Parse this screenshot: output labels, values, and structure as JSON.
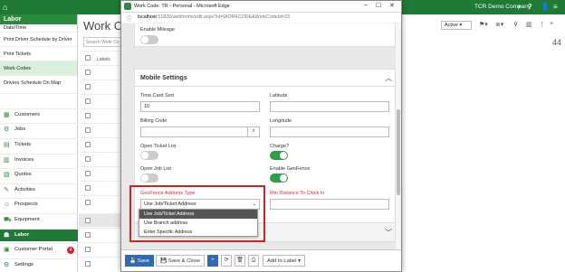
{
  "topbar": {
    "company": "TCR Demo Company",
    "colors": {
      "bg": "#1e7a34"
    }
  },
  "sidebar": {
    "header": "Labor",
    "sub_items": [
      {
        "label": "Date/Time"
      },
      {
        "label": "Print Driver Schedule by Driver"
      },
      {
        "label": "Print Tickets"
      },
      {
        "label": "Work Codes",
        "active": true
      },
      {
        "label": "Drivers Schedule On Map"
      }
    ],
    "nav": [
      {
        "label": "Customers",
        "icon": "building-icon"
      },
      {
        "label": "Jobs",
        "icon": "user-gear-icon"
      },
      {
        "label": "Tickets",
        "icon": "ticket-icon"
      },
      {
        "label": "Invoices",
        "icon": "invoice-icon"
      },
      {
        "label": "Quotes",
        "icon": "quote-icon"
      },
      {
        "label": "Activities",
        "icon": "wrench-icon"
      },
      {
        "label": "Prospects",
        "icon": "prospect-icon"
      },
      {
        "label": "Equipment",
        "icon": "truck-icon"
      },
      {
        "label": "Labor",
        "icon": "users-icon",
        "active": true
      },
      {
        "label": "Customer Portal",
        "icon": "portal-icon",
        "badge": "4"
      },
      {
        "label": "Settings",
        "icon": "gear-icon"
      }
    ]
  },
  "main": {
    "title": "Work Co",
    "search_placeholder": "Search Work Co",
    "labels_header": "Labels",
    "status_select": "Active",
    "count": "44"
  },
  "window": {
    "title": "Work Code: TR - Personal - Microsoft Edge",
    "url_host": "localhost",
    "url_path": ":51826/webforms/edit.aspx?id=WORKCODE&WorkCodeId=23",
    "enable_mileage_label": "Enable Mileage",
    "enable_mileage_on": false,
    "mobile_settings": {
      "title": "Mobile Settings",
      "time_card_sort_label": "Time Card Sort",
      "time_card_sort_value": "10",
      "latitude_label": "Latitude",
      "latitude_value": "",
      "billing_code_label": "Billing Code",
      "billing_code_value": "",
      "longitude_label": "Longitude",
      "longitude_value": "",
      "open_ticket_list_label": "Open Ticket List",
      "open_ticket_list_on": false,
      "charge_label": "Charge?",
      "charge_on": true,
      "open_job_list_label": "Open Job List",
      "open_job_list_on": false,
      "enable_geofence_label": "Enable GeoFence",
      "enable_geofence_on": true,
      "geofence_address_type_label": "GeoFence Address Type",
      "geofence_address_type_value": "Use Job/Ticket Address",
      "geofence_options": [
        "Use Job/Ticket Address",
        "Use Branch address",
        "Enter Specific Address"
      ],
      "min_distance_label": "Min Distance To Clock In",
      "min_distance_value": ""
    },
    "collapsed_section_initial": "R",
    "footer": {
      "save": "Save",
      "save_close": "Save & Close",
      "add_to_label": "Add to Label"
    },
    "colors": {
      "primary": "#2f6ab3",
      "toggle_on": "#2e9e48",
      "required": "#d62a2a",
      "highlight": "#d42020"
    }
  }
}
